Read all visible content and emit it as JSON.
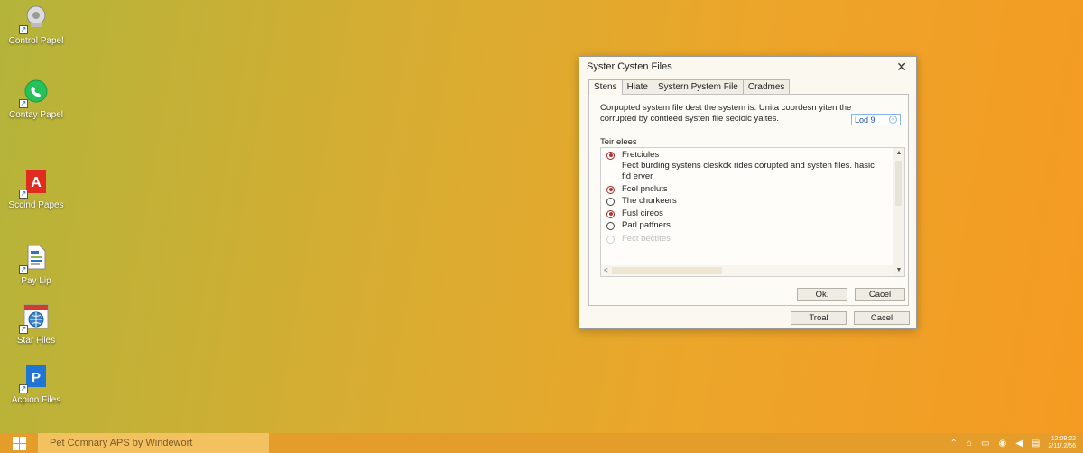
{
  "desktop": {
    "icons": [
      {
        "label": "Control Papel",
        "icon": "control-panel-icon"
      },
      {
        "label": "Contay Papel",
        "icon": "whatsapp-icon"
      },
      {
        "label": "Sccind Papes",
        "icon": "acrobat-icon"
      },
      {
        "label": "Pay Lip",
        "icon": "document-icon"
      },
      {
        "label": "Star Files",
        "icon": "globe-calendar-icon"
      },
      {
        "label": "Acpion Files",
        "icon": "publisher-icon"
      }
    ]
  },
  "dialog": {
    "title": "Syster Cysten Files",
    "tabs": [
      "Stens",
      "Hiate",
      "Systern Pystem File",
      "Cradmes"
    ],
    "active_tab": "Stens",
    "description": "Corpupted system file dest the system is. Unita coordesn yiten the corrupted by contleed systen file seciolc yaltes.",
    "level_select": "Lod 9",
    "list_title": "Teir elees",
    "options": [
      {
        "label": "Fretciules",
        "detail": "Fect burding systens cleskck rides corupted and systen files. hasic fid erver",
        "checked": true,
        "disabled": false
      },
      {
        "label": "Fcel pncluts",
        "detail": "",
        "checked": true,
        "disabled": false
      },
      {
        "label": "The churkeers",
        "detail": "",
        "checked": false,
        "disabled": false
      },
      {
        "label": "Fusl cireos",
        "detail": "",
        "checked": true,
        "disabled": false
      },
      {
        "label": "Parl patfners",
        "detail": "",
        "checked": false,
        "disabled": false
      },
      {
        "label": "Fect bectites",
        "detail": "",
        "checked": false,
        "disabled": true
      }
    ],
    "buttons": {
      "ok": "Ok.",
      "cancel_inner": "Cacel",
      "trial": "Troal",
      "cancel_outer": "Cacel"
    }
  },
  "taskbar": {
    "search_text": "Pet Comnary APS by Windewort",
    "tray_icons": [
      "chevron-up-icon",
      "network-icon",
      "battery-icon",
      "wifi-icon",
      "volume-icon",
      "message-icon"
    ],
    "clock_time": "12:09:22",
    "clock_date": "2/11/.2/56"
  },
  "colors": {
    "accent_radio": "#b8312f",
    "taskbar": "#e49d2a"
  }
}
